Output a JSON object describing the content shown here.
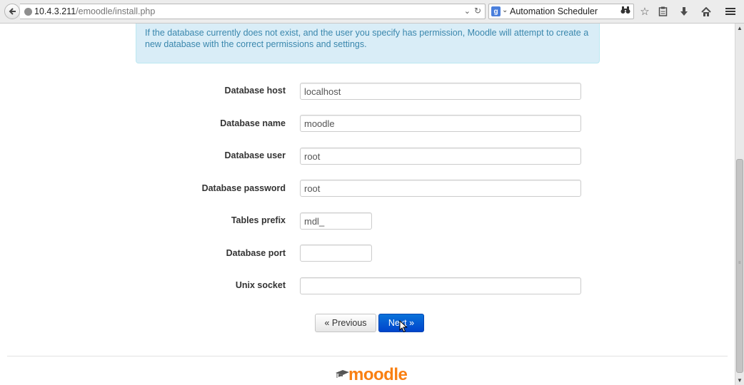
{
  "browser": {
    "url_host": "10.4.3.211",
    "url_path": "/emoodle/install.php",
    "search_text": "Automation Scheduler",
    "search_engine_letter": "g"
  },
  "info": {
    "text": "If the database currently does not exist, and the user you specify has permission, Moodle will attempt to create a new database with the correct permissions and settings."
  },
  "form": {
    "fields": [
      {
        "label": "Database host",
        "value": "localhost"
      },
      {
        "label": "Database name",
        "value": "moodle"
      },
      {
        "label": "Database user",
        "value": "root"
      },
      {
        "label": "Database password",
        "value": "root"
      },
      {
        "label": "Tables prefix",
        "value": "mdl_"
      },
      {
        "label": "Database port",
        "value": ""
      },
      {
        "label": "Unix socket",
        "value": ""
      }
    ],
    "previous_label": "« Previous",
    "next_label": "Next »"
  },
  "footer": {
    "logo_text": "moodle"
  },
  "colors": {
    "info_bg": "#d9edf7",
    "info_text": "#3a87ad",
    "primary_button": "#0044cc",
    "logo_orange": "#f98012"
  },
  "icons": [
    "back-arrow-icon",
    "globe-icon",
    "dropdown-icon",
    "reload-icon",
    "search-engine-icon",
    "binoculars-icon",
    "star-icon",
    "clipboard-icon",
    "download-icon",
    "home-icon",
    "menu-icon",
    "mortarboard-icon",
    "mouse-cursor-icon"
  ]
}
